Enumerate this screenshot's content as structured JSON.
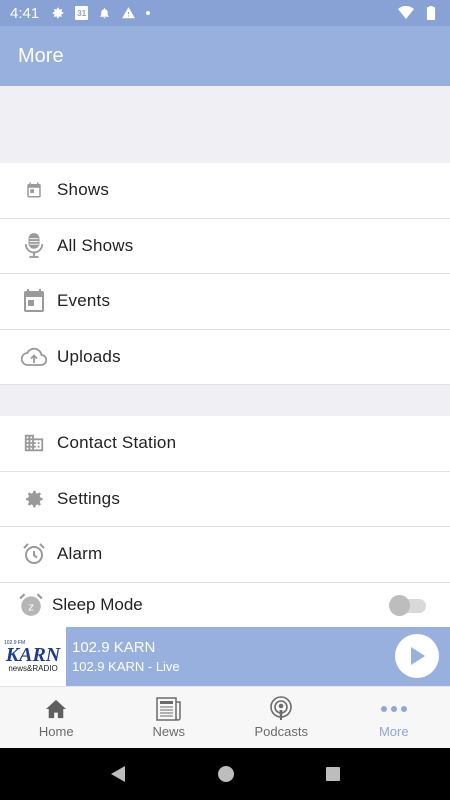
{
  "status": {
    "time": "4:41",
    "icons": [
      "gear-icon",
      "calendar-icon",
      "bell-icon",
      "warning-icon",
      "dot-icon",
      "wifi-icon",
      "battery-icon"
    ],
    "calendar_day": "31"
  },
  "header": {
    "title": "More"
  },
  "groups": [
    {
      "items": [
        {
          "label": "Shows",
          "icon": "calendar-small-icon"
        },
        {
          "label": "All Shows",
          "icon": "microphone-icon"
        },
        {
          "label": "Events",
          "icon": "calendar-icon"
        },
        {
          "label": "Uploads",
          "icon": "cloud-upload-icon"
        }
      ]
    },
    {
      "items": [
        {
          "label": "Contact Station",
          "icon": "building-icon"
        },
        {
          "label": "Settings",
          "icon": "gear-icon"
        },
        {
          "label": "Alarm",
          "icon": "alarm-clock-icon"
        }
      ]
    }
  ],
  "sleep_mode": {
    "label": "Sleep Mode",
    "icon": "sleep-clock-icon",
    "enabled": false
  },
  "player": {
    "logo_top": "102.9 FM",
    "logo_main": "KARN",
    "logo_sub": "news&RADIO",
    "station": "102.9 KARN",
    "subtitle": "102.9 KARN - Live",
    "state": "paused"
  },
  "tabs": [
    {
      "label": "Home",
      "icon": "home-icon",
      "active": false
    },
    {
      "label": "News",
      "icon": "newspaper-icon",
      "active": false
    },
    {
      "label": "Podcasts",
      "icon": "podcast-icon",
      "active": false
    },
    {
      "label": "More",
      "icon": "more-dots-icon",
      "active": true
    }
  ],
  "colors": {
    "header": "#98b0dd",
    "status_bar": "#88a2d6",
    "accent": "#8ea6d8",
    "icon_gray": "#9a9a9a"
  }
}
